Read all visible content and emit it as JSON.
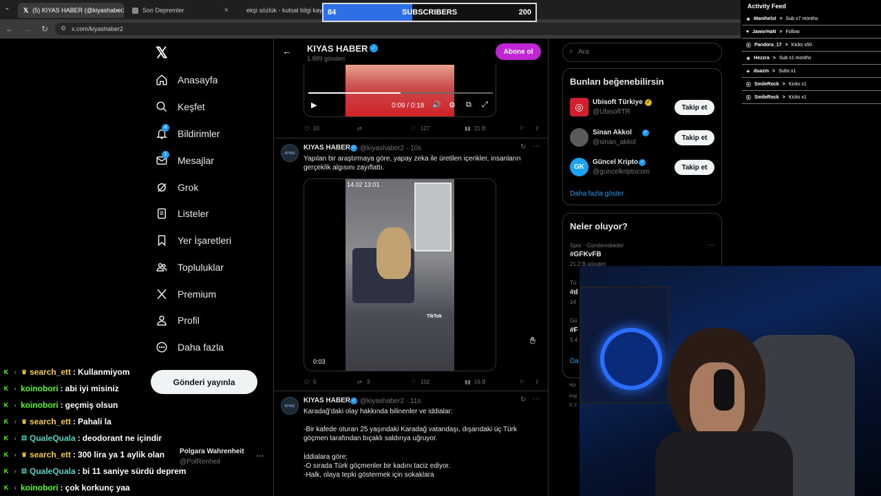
{
  "browser": {
    "tabs": [
      {
        "label": "(5) KIYAS HABER (@kiyashaber2)",
        "icon": "x-logo-icon",
        "active": true
      },
      {
        "label": "Son Depremler",
        "icon": "page-icon",
        "active": false
      },
      {
        "label": "ekşi sözlük - kutsal bilgi kayn",
        "icon": "drop-icon",
        "active": false
      }
    ],
    "url": "x.com/kiyashaber2"
  },
  "subscribers": {
    "current": "84",
    "label": "SUBSCRIBERS",
    "goal": "200",
    "progress": 0.42
  },
  "nav": {
    "items": [
      {
        "label": "Anasayfa",
        "icon": "home-icon"
      },
      {
        "label": "Keşfet",
        "icon": "search-icon"
      },
      {
        "label": "Bildirimler",
        "icon": "bell-icon",
        "badge": "4"
      },
      {
        "label": "Mesajlar",
        "icon": "mail-icon",
        "badge": "1"
      },
      {
        "label": "Grok",
        "icon": "grok-icon"
      },
      {
        "label": "Listeler",
        "icon": "list-icon"
      },
      {
        "label": "Yer İşaretleri",
        "icon": "bookmark-icon"
      },
      {
        "label": "Topluluklar",
        "icon": "people-icon"
      },
      {
        "label": "Premium",
        "icon": "x-logo-icon"
      },
      {
        "label": "Profil",
        "icon": "person-icon"
      },
      {
        "label": "Daha fazla",
        "icon": "more-icon"
      }
    ],
    "post_button": "Gönderi yayınla",
    "account": {
      "name": "Polgara Wahrenheit",
      "handle": "@PolRenheit"
    }
  },
  "profile_header": {
    "name": "KIYAS HABER",
    "posts": "1.889 gönderi",
    "subscribe": "Abone ol"
  },
  "video1": {
    "time": "0:09 / 0:18",
    "progress": 0.5
  },
  "tweet0_actions": {
    "replies": "10",
    "retweets": "",
    "likes": "127",
    "views": "21 B"
  },
  "tweet1": {
    "name": "KIYAS HABER",
    "handle": "@kiyashaber2 · 10s",
    "text": "Yapılan bir araştırmaya göre, yapay zeka ile üretilen içerikler, insanların gerçeklik algısını zayıflattı.",
    "video_time": "0:03",
    "overlay_time": "14.02 13:01",
    "watermark": "TikTok",
    "replies": "5",
    "retweets": "3",
    "likes": "102",
    "views": "16 B"
  },
  "tweet2": {
    "name": "KIYAS HABER",
    "handle": "@kiyashaber2 · 11s",
    "line1": "Karadağ'daki olay hakkında bilinenler ve iddialar:",
    "line2": "-Bir kafede oturan 25 yaşındaki Karadağ vatandaşı, dışarıdaki üç Türk göçmen tarafından bıçaklı saldırıya uğruyor.",
    "line3": "İddialara göre;",
    "line4": "-O sırada Türk göçmenler bir kadını taciz ediyor.",
    "line5": "-Halk, olaya tepki göstermek için sokaklara"
  },
  "search": {
    "placeholder": "Ara"
  },
  "who_to_follow": {
    "title": "Bunları beğenebilirsin",
    "accounts": [
      {
        "name": "Ubisoft Türkiye",
        "handle": "@UbisoftTR",
        "button": "Takip et"
      },
      {
        "name": "Sinan Akkol",
        "handle": "@sinan_akkol",
        "button": "Takip et"
      },
      {
        "name": "Güncel Kripto",
        "handle": "@guncelkriptocom",
        "button": "Takip et"
      }
    ],
    "more": "Daha fazla göster"
  },
  "trends": {
    "title": "Neler oluyor?",
    "items": [
      {
        "context": "Spor · Gündemdekiler",
        "name": "#GFKvFB",
        "count": "21,2 B gönderi"
      }
    ],
    "partial": [
      "Tü",
      "#d",
      "14",
      "Gü",
      "#F",
      "5.4",
      "Da"
    ],
    "footer": [
      "Hiz",
      "Imp",
      "© 2"
    ]
  },
  "activity_feed": {
    "title": "Activity Feed",
    "items": [
      {
        "icon": "star-icon",
        "user": "Manihelst",
        "event": "Sub x7 months"
      },
      {
        "icon": "heart-icon",
        "user": "JaworHaN",
        "event": "Follow"
      },
      {
        "icon": "kick-icon",
        "user": "Pandora_17",
        "event": "Kicks x50"
      },
      {
        "icon": "star-icon",
        "user": "Hezzra",
        "event": "Sub x1 months"
      },
      {
        "icon": "gift-icon",
        "user": "duazm",
        "event": "Subs x1"
      },
      {
        "icon": "kick-icon",
        "user": "SmileRock",
        "event": "Kicks x1"
      },
      {
        "icon": "kick-icon",
        "user": "SmileRock",
        "event": "Kicks x1"
      }
    ]
  },
  "chat": [
    {
      "user": "search_ett",
      "color": "#f2c94c",
      "badge": "crown",
      "msg": "Kullanmiyom"
    },
    {
      "user": "koinobori",
      "color": "#53fc18",
      "badge": "",
      "msg": "abi iyi misiniz"
    },
    {
      "user": "koinobori",
      "color": "#53fc18",
      "badge": "",
      "msg": "geçmiş olsun"
    },
    {
      "user": "search_ett",
      "color": "#f2c94c",
      "badge": "crown",
      "msg": "Pahali la"
    },
    {
      "user": "QualeQuala",
      "color": "#4fd1c5",
      "badge": "gift",
      "msg": "deodorant ne içindir"
    },
    {
      "user": "search_ett",
      "color": "#f2c94c",
      "badge": "crown",
      "msg": "300 lira ya 1 aylik olan"
    },
    {
      "user": "QualeQuala",
      "color": "#4fd1c5",
      "badge": "gift",
      "msg": "bi 11 saniye sürdü deprem"
    },
    {
      "user": "koinobori",
      "color": "#53fc18",
      "badge": "",
      "msg": "çok korkunç yaa"
    }
  ]
}
